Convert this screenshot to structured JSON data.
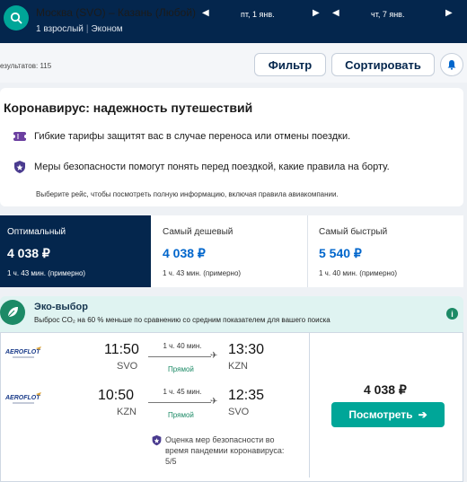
{
  "header": {
    "route": "Москва (SVO) – Казань (Любой)",
    "passengers": "1 взрослый",
    "cabin": "Эконом",
    "depart_date": "пт, 1 янв.",
    "return_date": "чт, 7 янв."
  },
  "toolbar": {
    "results": "езультатов: 115",
    "filter_label": "Фильтр",
    "sort_label": "Сортировать"
  },
  "covid": {
    "title": "Коронавирус: надежность путешествий",
    "flexible": "Гибкие тарифы защитят вас в случае переноса или отмены поездки.",
    "safety": "Меры безопасности помогут понять перед поездкой, какие правила на борту.",
    "note": "Выберите рейс, чтобы посмотреть полную информацию, включая правила авиакомпании."
  },
  "sort_tabs": [
    {
      "label": "Оптимальный",
      "price": "4 038 ₽",
      "duration": "1 ч. 43 мин. (примерно)"
    },
    {
      "label": "Самый дешевый",
      "price": "4 038 ₽",
      "duration": "1 ч. 43 мин. (примерно)"
    },
    {
      "label": "Самый быстрый",
      "price": "5 540 ₽",
      "duration": "1 ч. 40 мин. (примерно)"
    }
  ],
  "eco": {
    "title": "Эко-выбор",
    "text": "Выброс CO₂ на 60 % меньше по сравнению со средним показателем для вашего поиска",
    "info": "i"
  },
  "flight": {
    "legs": [
      {
        "depart_time": "11:50",
        "depart_code": "SVO",
        "arrive_time": "13:30",
        "arrive_code": "KZN",
        "duration": "1 ч. 40 мин.",
        "stops": "Прямой",
        "airline": "AEROFLOT"
      },
      {
        "depart_time": "10:50",
        "depart_code": "KZN",
        "arrive_time": "12:35",
        "arrive_code": "SVO",
        "duration": "1 ч. 45 мин.",
        "stops": "Прямой",
        "airline": "AEROFLOT"
      }
    ],
    "rating_line1": "Оценка мер безопасности во",
    "rating_line2": "время пандемии коронавируса:",
    "rating_line3": "5/5",
    "price": "4 038 ₽",
    "view_label": "Посмотреть"
  },
  "colors": {
    "navy": "#04264d",
    "teal": "#00a698",
    "green": "#1c8a66",
    "blue": "#0066cc"
  }
}
